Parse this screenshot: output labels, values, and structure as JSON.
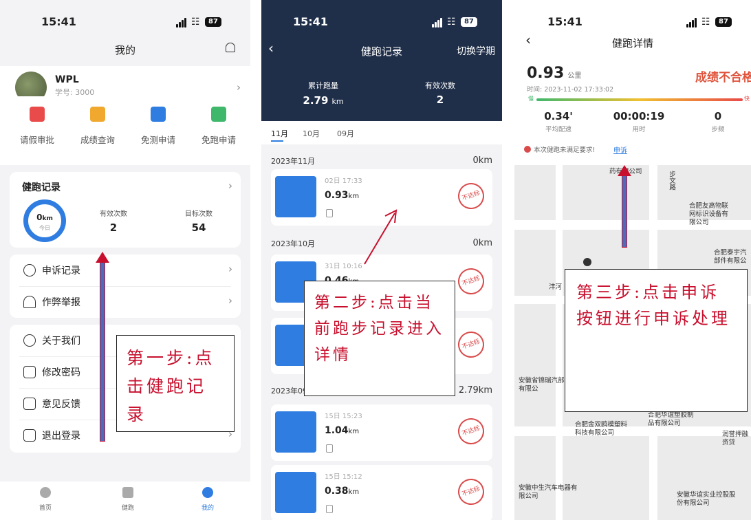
{
  "screen1": {
    "status": {
      "time": "15:41",
      "battery": "87"
    },
    "header": {
      "title": "我的"
    },
    "profile": {
      "name": "WPL",
      "student_id": "学号: 3000"
    },
    "quick_actions": [
      {
        "label": "请假审批",
        "icon": "calendar-check-icon",
        "color": "#e94a4a"
      },
      {
        "label": "成绩查询",
        "icon": "grade-search-icon",
        "color": "#f0a92e"
      },
      {
        "label": "免测申请",
        "icon": "exempt-icon",
        "color": "#2f7de1"
      },
      {
        "label": "免跑申请",
        "icon": "edit-doc-icon",
        "color": "#3fb86b"
      }
    ],
    "run_card": {
      "title": "健跑记录",
      "ring_value": "0",
      "ring_unit": "km",
      "ring_caption": "今日",
      "valid_label": "有效次数",
      "valid_value": "2",
      "target_label": "目标次数",
      "target_value": "54"
    },
    "menu_group1": [
      {
        "label": "申诉记录",
        "icon": "clock-icon"
      },
      {
        "label": "作弊举报",
        "icon": "alarm-icon"
      }
    ],
    "menu_group2": [
      {
        "label": "关于我们",
        "icon": "info-icon"
      },
      {
        "label": "修改密码",
        "icon": "lock-icon"
      },
      {
        "label": "意见反馈",
        "icon": "feedback-icon"
      },
      {
        "label": "退出登录",
        "icon": "logout-icon"
      }
    ],
    "tabs": [
      {
        "label": "首页",
        "icon": "home-icon"
      },
      {
        "label": "健跑",
        "icon": "run-icon"
      },
      {
        "label": "我的",
        "icon": "profile-icon"
      }
    ],
    "callout": "第一步:点击健跑记录"
  },
  "screen2": {
    "status": {
      "time": "15:41",
      "battery": "87"
    },
    "header": {
      "title": "健跑记录",
      "action": "切换学期"
    },
    "summary": {
      "total_label": "累计跑量",
      "total_value": "2.79",
      "total_unit": "km",
      "valid_label": "有效次数",
      "valid_value": "2"
    },
    "month_tabs": [
      "11月",
      "10月",
      "09月"
    ],
    "groups": [
      {
        "month": "2023年11月",
        "total": "0km",
        "records": [
          {
            "time": "02日 17:33",
            "dist": "0.93",
            "unit": "km",
            "stamp": "不达标"
          }
        ]
      },
      {
        "month": "2023年10月",
        "total": "0km",
        "records": [
          {
            "time": "31日 10:16",
            "dist": "0.46",
            "unit": "km",
            "stamp": "不达标"
          },
          {
            "time": "",
            "dist": "",
            "unit": "",
            "stamp": "不达标"
          }
        ]
      },
      {
        "month": "2023年09月",
        "total": "2.79km",
        "records": [
          {
            "time": "15日 15:23",
            "dist": "1.04",
            "unit": "km",
            "stamp": "不达标"
          },
          {
            "time": "15日 15:12",
            "dist": "0.38",
            "unit": "km",
            "stamp": "不达标"
          }
        ]
      }
    ],
    "callout": "第二步:点击当前跑步记录进入详情"
  },
  "screen3": {
    "status": {
      "time": "15:41",
      "battery": "87"
    },
    "header": {
      "title": "健跑详情"
    },
    "distance": {
      "value": "0.93",
      "unit": "公里"
    },
    "datetime": "时间: 2023-11-02 17:33:02",
    "result": "成绩不合格",
    "speed_bar": {
      "slow": "慢",
      "fast": "快"
    },
    "stats": [
      {
        "value": "0.34'",
        "label": "平均配速"
      },
      {
        "value": "00:00:19",
        "label": "用时"
      },
      {
        "value": "0",
        "label": "步频"
      }
    ],
    "warning": "本次健跑未满足要求!",
    "appeal": "申诉",
    "map_labels": [
      "合肥友高物联网标识设备有限公司",
      "合肥泰宇汽部件有限公",
      "沣河",
      "安徽省锦瑞汽部件有限公",
      "合肥金双鸥模塑料科技有限公司",
      "合肥华谊塑胶制品有限公司",
      "润誉押融资贷",
      "安徽中生汽车电器有限公司",
      "安徽华谊实业控股股份有限公司",
      "步文路",
      "药有限公司"
    ],
    "callout": "第三步:点击申诉按钮进行申诉处理"
  }
}
